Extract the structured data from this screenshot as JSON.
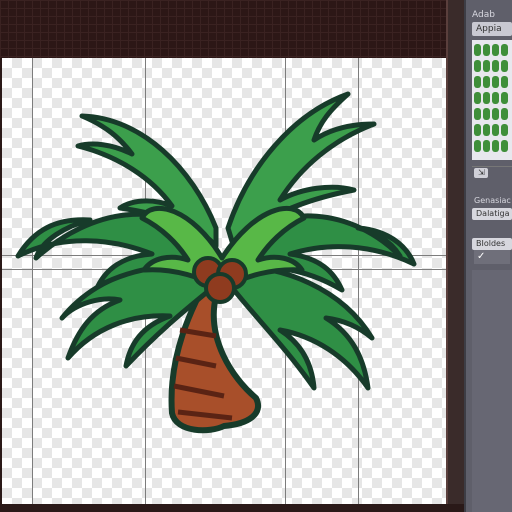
{
  "panel": {
    "title": "Adab",
    "tab_label": "Appia",
    "label_1": "Genasiac",
    "field_1": "Dalatiga",
    "field_2": "BIoldes",
    "check_mark": "✓",
    "small_button": "⇲"
  },
  "canvas": {
    "background": "transparent-checkerboard",
    "subject": "palm-tree-illustration"
  },
  "colors": {
    "leaf_light": "#58b847",
    "leaf_dark": "#1f6d3e",
    "trunk": "#a84f2a",
    "outline": "#173b2a"
  }
}
